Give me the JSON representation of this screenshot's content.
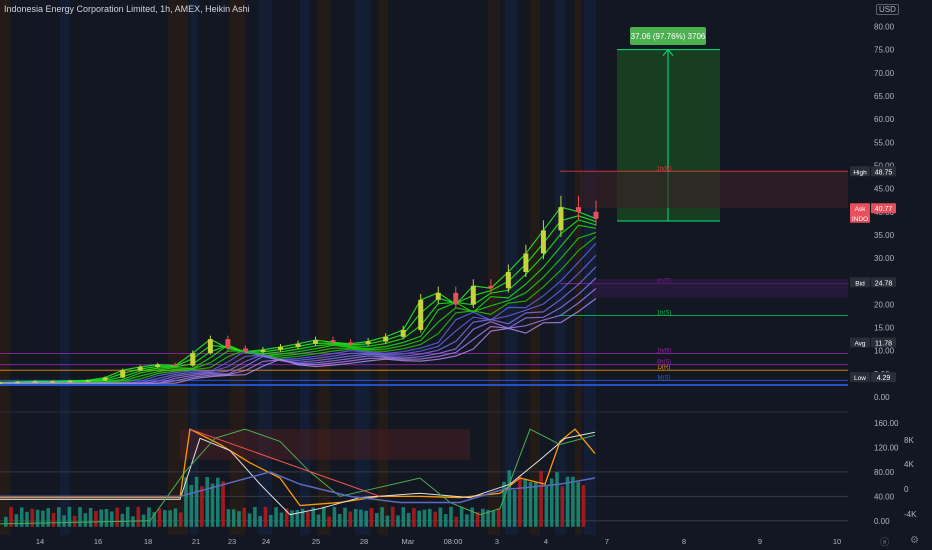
{
  "header": {
    "title": "Indonesia Energy Corporation Limited, 1h, AMEX, Heikin Ashi",
    "currency": "USD"
  },
  "chart_data": [
    {
      "type": "candlestick",
      "title": "Indonesia Energy Corporation Limited, 1h, AMEX, Heikin Ashi",
      "y_ticks": [
        "80.00",
        "75.00",
        "70.00",
        "65.00",
        "60.00",
        "55.00",
        "50.00",
        "45.00",
        "40.00",
        "35.00",
        "30.00",
        "25.00",
        "20.00",
        "15.00",
        "10.00",
        "5.00",
        "0.00"
      ],
      "y_tick_values": [
        80,
        75,
        70,
        65,
        60,
        55,
        50,
        45,
        40,
        35,
        30,
        25,
        20,
        15,
        10,
        5,
        0
      ],
      "ylim": [
        -1.5,
        84
      ],
      "x_ticks": [
        "14",
        "16",
        "18",
        "21",
        "23",
        "24",
        "25",
        "28",
        "Mar",
        "08:00",
        "3",
        "4",
        "7",
        "8",
        "9",
        "10"
      ],
      "price_labels": [
        {
          "name": "High",
          "value": "48.75",
          "num": 48.75,
          "color": "#2a2e39"
        },
        {
          "name": "Ask",
          "value": "40.77",
          "num": 40.77,
          "color": "#e5505c"
        },
        {
          "name": "INDO",
          "value": "",
          "num": 38.7,
          "color": "#e5505c"
        },
        {
          "name": "Bid",
          "value": "24.78",
          "num": 24.78,
          "color": "#2a2e39"
        },
        {
          "name": "Avg",
          "value": "11.78",
          "num": 11.78,
          "color": "#2a2e39"
        },
        {
          "name": "Low",
          "value": "4.29",
          "num": 4.29,
          "color": "#2a2e39"
        }
      ],
      "levels": [
        {
          "label": "1h(R)",
          "value": 48.75
        },
        {
          "label": "4h(R)",
          "value": 24.5
        },
        {
          "label": "1h(S)",
          "value": 17.6
        },
        {
          "label": "1h(R)",
          "value": 9.4
        },
        {
          "label": "4h(S)",
          "value": 7.0
        },
        {
          "label": "D(R)",
          "value": 5.8
        },
        {
          "label": "M(S)",
          "value": 3.6
        }
      ],
      "measure": {
        "text": "37.06 (97.76%) 3706",
        "from": 38.0,
        "to": 75.0
      },
      "candle_series": [
        3.2,
        3.3,
        3.4,
        3.4,
        3.5,
        3.6,
        4.2,
        5.8,
        6.5,
        7.0,
        6.8,
        9.5,
        12.5,
        10.5,
        9.8,
        10.2,
        10.8,
        11.5,
        12.3,
        11.8,
        11.5,
        12.0,
        13.0,
        14.5,
        21.0,
        22.5,
        20.0,
        24.0,
        23.5,
        27.0,
        31.0,
        36.0,
        41.0,
        40.0,
        38.5
      ]
    },
    {
      "type": "line",
      "y_ticks": [
        "160.00",
        "120.00",
        "80.00",
        "40.00",
        "0.00"
      ],
      "y_tick_values": [
        160,
        120,
        80,
        40,
        0
      ],
      "ylim": [
        -20,
        165
      ],
      "secondary_y_ticks": [
        "8K",
        "4K",
        "0",
        "-4K"
      ]
    }
  ]
}
